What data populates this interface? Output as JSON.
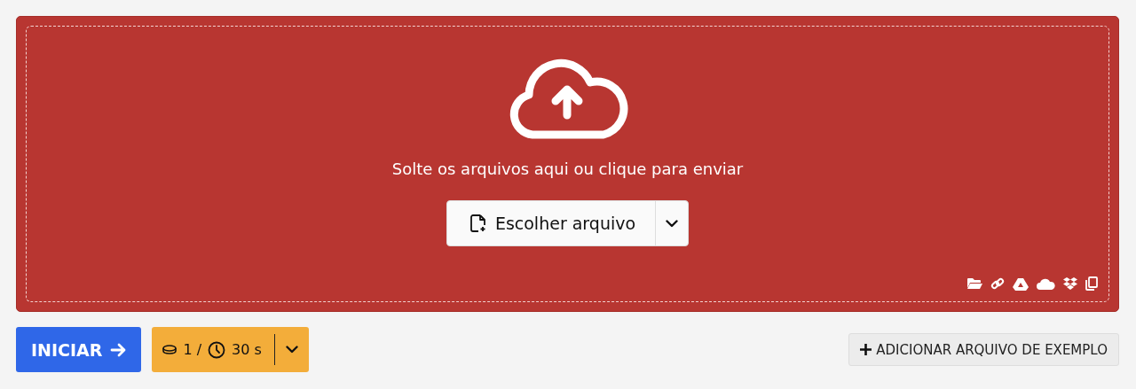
{
  "dropzone": {
    "message": "Solte os arquivos aqui ou clique para enviar",
    "choose_button": {
      "label": "Escolher arquivo"
    }
  },
  "actions": {
    "start_button": {
      "label": "INICIAR"
    },
    "credits_button": {
      "credits": "1 /",
      "time": "30 s"
    },
    "example_button": {
      "label": "ADICIONAR ARQUIVO DE EXEMPLO"
    }
  }
}
